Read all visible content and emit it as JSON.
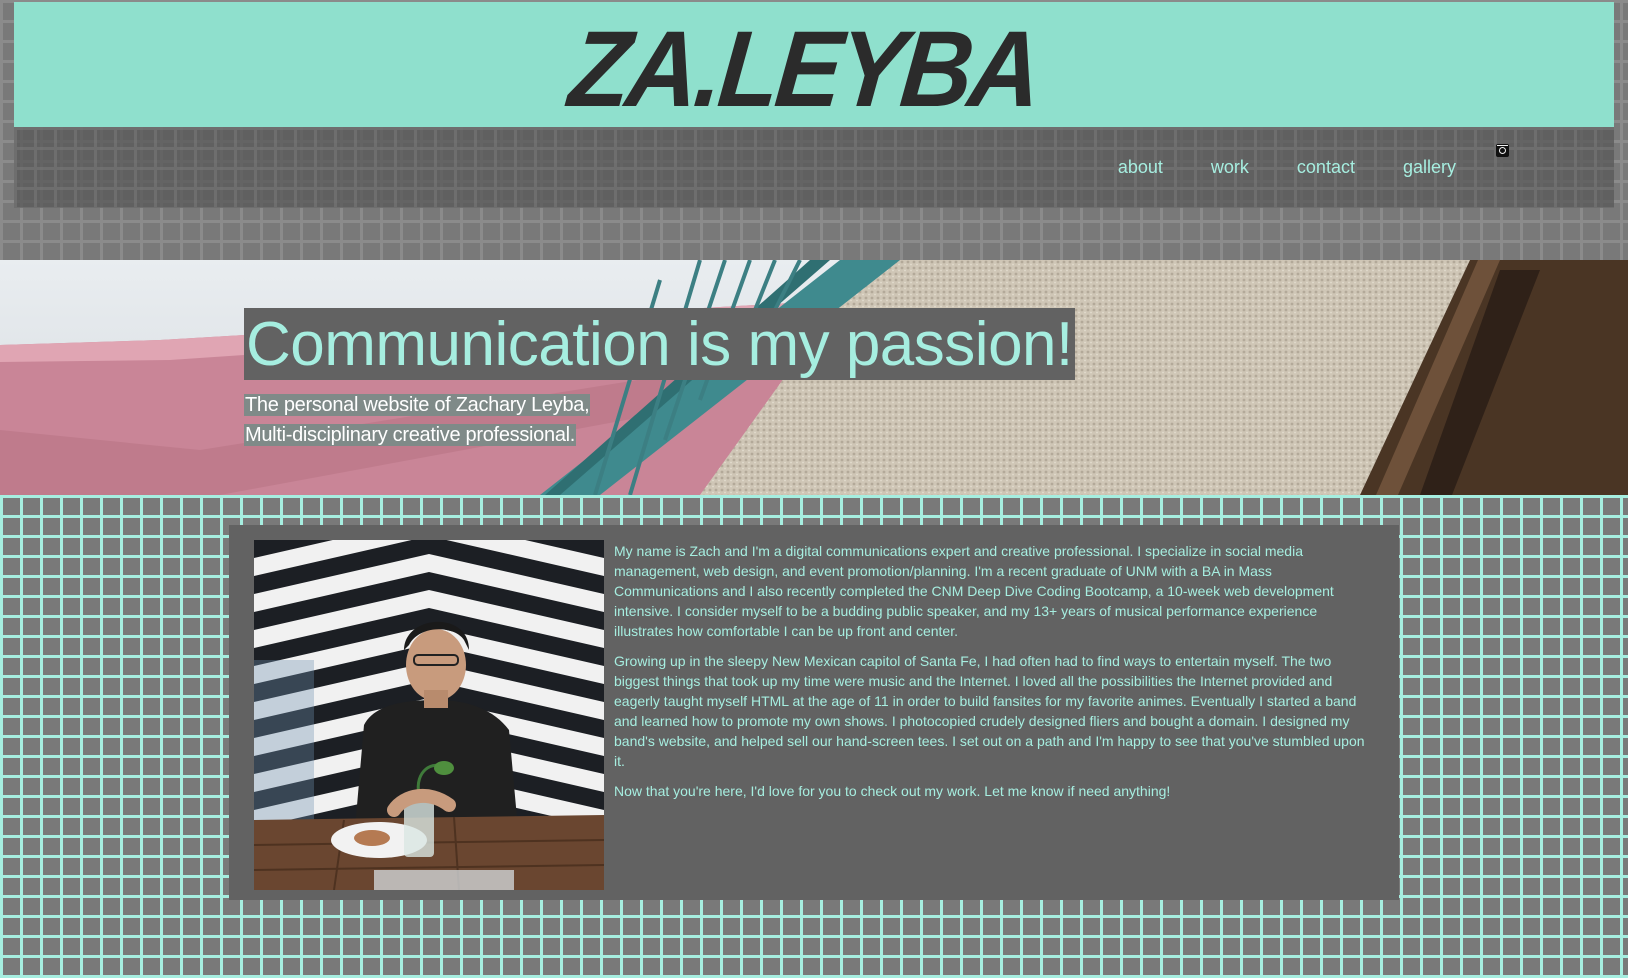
{
  "site": {
    "logo": "ZA.LEYBA",
    "colors": {
      "accent": "#8fe0cd",
      "accent_text": "#a6eee0",
      "panel": "#626262",
      "logo_text": "#2b2b2b"
    }
  },
  "nav": {
    "items": [
      {
        "label": "about"
      },
      {
        "label": "work"
      },
      {
        "label": "contact"
      },
      {
        "label": "gallery"
      }
    ],
    "icon": "instagram-icon"
  },
  "hero": {
    "title": "Communication is my passion!",
    "subtitle_line1": "The personal website of Zachary Leyba,",
    "subtitle_line2": "Multi-disciplinary creative professional."
  },
  "about": {
    "paragraphs": [
      "My name is Zach and I'm a digital communications expert and creative professional. I specialize in social media management, web design, and event promotion/planning. I'm a recent graduate of UNM with a BA in Mass Communications and I also recently completed the CNM Deep Dive Coding Bootcamp, a 10-week web development intensive. I consider myself to be a budding public speaker, and my 13+ years of musical performance experience illustrates how comfortable I can be up front and center.",
      "Growing up in the sleepy New Mexican capitol of Santa Fe, I had often had to find ways to entertain myself. The two biggest things that took up my time were music and the Internet. I loved all the possibilities the Internet provided and eagerly taught myself HTML at the age of 11 in order to build fansites for my favorite animes. Eventually I started a band and learned how to promote my own shows. I photocopied crudely designed fliers and bought a domain. I designed my band's website, and helped sell our hand-screen tees. I set out on a path and I'm happy to see that you've stumbled upon it.",
      "Now that you're here, I'd love for you to check out my work. Let me know if need anything!"
    ]
  }
}
